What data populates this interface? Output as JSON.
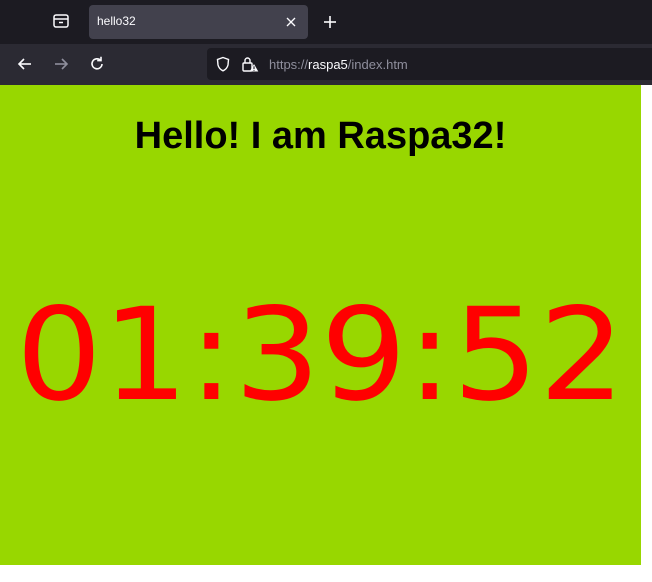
{
  "browser": {
    "tab": {
      "title": "hello32"
    },
    "url": {
      "scheme": "https://",
      "host": "raspa5",
      "path": "/index.htm"
    }
  },
  "page": {
    "heading": "Hello! I am Raspa32!",
    "clock": "01:39:52",
    "background_color": "#98d700",
    "clock_color": "#ff0000"
  }
}
